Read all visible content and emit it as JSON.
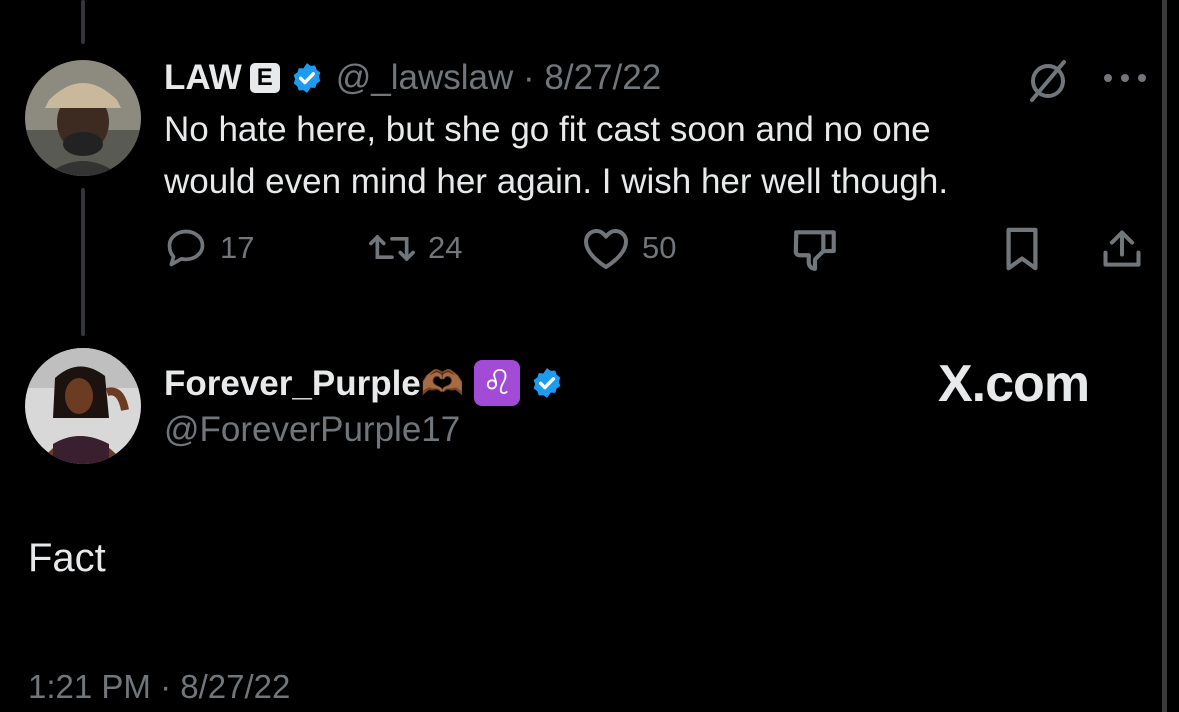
{
  "parent_tweet": {
    "display_name": "LAW",
    "badge_letter": "E",
    "handle_date": "@_lawslaw · 8/27/22",
    "text_line1": "No hate here, but she go fit cast soon and no one",
    "text_line2": "would even mind her again. I wish her well though.",
    "replies": "17",
    "retweets": "24",
    "likes": "50",
    "icons": [
      "grok-icon",
      "more-icon",
      "reply-icon",
      "retweet-icon",
      "like-icon",
      "dislike-icon",
      "bookmark-icon",
      "share-icon"
    ]
  },
  "main_tweet": {
    "display_name": "Forever_Purple🫶🏾",
    "zodiac": "♌",
    "handle": "@ForeverPurple17",
    "text": "Fact",
    "timestamp": "1:21 PM · 8/27/22"
  },
  "watermark": "X.com",
  "colors": {
    "background": "#000000",
    "text": "#e7e9ea",
    "muted": "#71767b",
    "verified": "#1d9bf0",
    "zodiac_bg": "#a24bd6"
  }
}
